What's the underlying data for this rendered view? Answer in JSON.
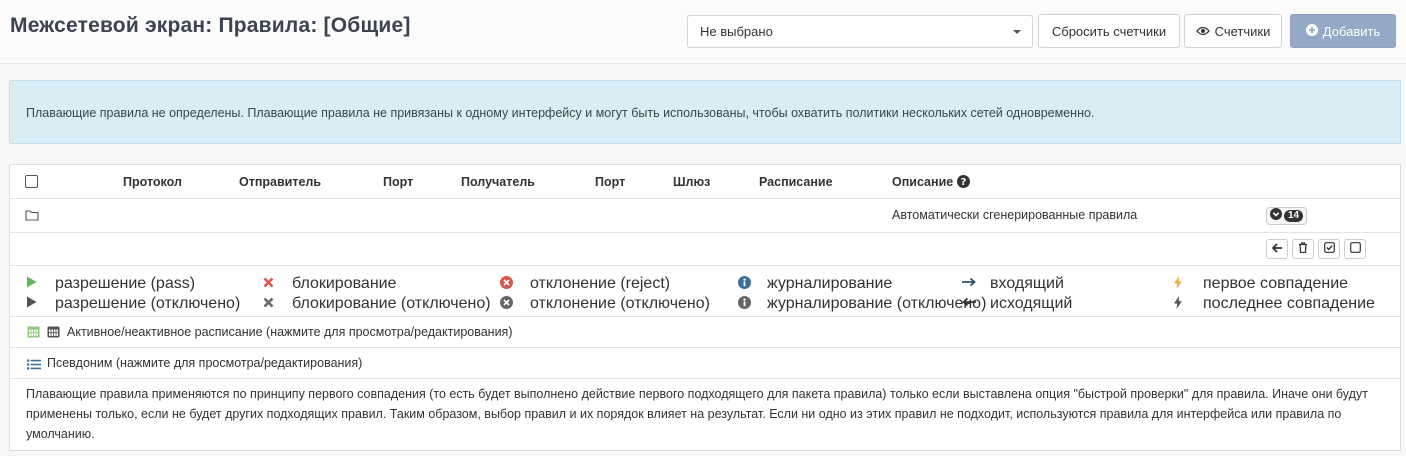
{
  "header": {
    "title": "Межсетевой экран: Правила: [Общие]",
    "select_value": "Не выбрано",
    "reset_counters": "Сбросить счетчики",
    "counters": "Счетчики",
    "add": "Добавить"
  },
  "alert": {
    "text": "Плавающие правила не определены. Плавающие правила не привязаны к одному интерфейсу и могут быть использованы, чтобы охватить политики нескольких сетей одновременно."
  },
  "table": {
    "columns": [
      "Протокол",
      "Отправитель",
      "Порт",
      "Получатель",
      "Порт",
      "Шлюз",
      "Расписание",
      "Описание"
    ],
    "group_row": {
      "description": "Автоматически сгенерированные правила",
      "count": "14"
    }
  },
  "legend": {
    "items": [
      {
        "icon": "play-icon",
        "color": "#5cb85c",
        "label": "разрешение (pass)"
      },
      {
        "icon": "times-icon",
        "color": "#d9534f",
        "label": "блокирование"
      },
      {
        "icon": "times-circle-icon",
        "color": "#d9534f",
        "label": "отклонение (reject)"
      },
      {
        "icon": "info-circle-icon",
        "color": "#3a6f9a",
        "label": "журналирование"
      },
      {
        "icon": "arrow-right-icon",
        "color": "#2b4e6e",
        "label": "входящий"
      },
      {
        "icon": "bolt-icon",
        "color": "#f0ad4e",
        "label": "первое совпадение"
      },
      {
        "icon": "play-icon",
        "color": "#555555",
        "label": "разрешение (отключено)"
      },
      {
        "icon": "times-icon",
        "color": "#666666",
        "label": "блокирование (отключено)"
      },
      {
        "icon": "times-circle-icon",
        "color": "#666666",
        "label": "отклонение (отключено)"
      },
      {
        "icon": "info-circle-icon",
        "color": "#666666",
        "label": "журналирование (отключено)"
      },
      {
        "icon": "arrow-left-icon",
        "color": "#333333",
        "label": "исходящий"
      },
      {
        "icon": "bolt-icon",
        "color": "#555555",
        "label": "последнее совпадение"
      }
    ]
  },
  "schedule": {
    "label": "Активное/неактивное расписание (нажмите для просмотра/редактирования)"
  },
  "alias": {
    "label": "Псевдоним (нажмите для просмотра/редактирования)"
  },
  "footer": {
    "text": "Плавающие правила применяются по принципу первого совпадения (то есть будет выполнено действие первого подходящего для пакета правила) только если выставлена опция \"быстрой проверки\" для правила. Иначе они будут применены только, если не будет других подходящих правил. Таким образом, выбор правил и их порядок влияет на результат. Если ни одно из этих правил не подходит, используются правила для интерфейса или правила по умолчанию."
  }
}
